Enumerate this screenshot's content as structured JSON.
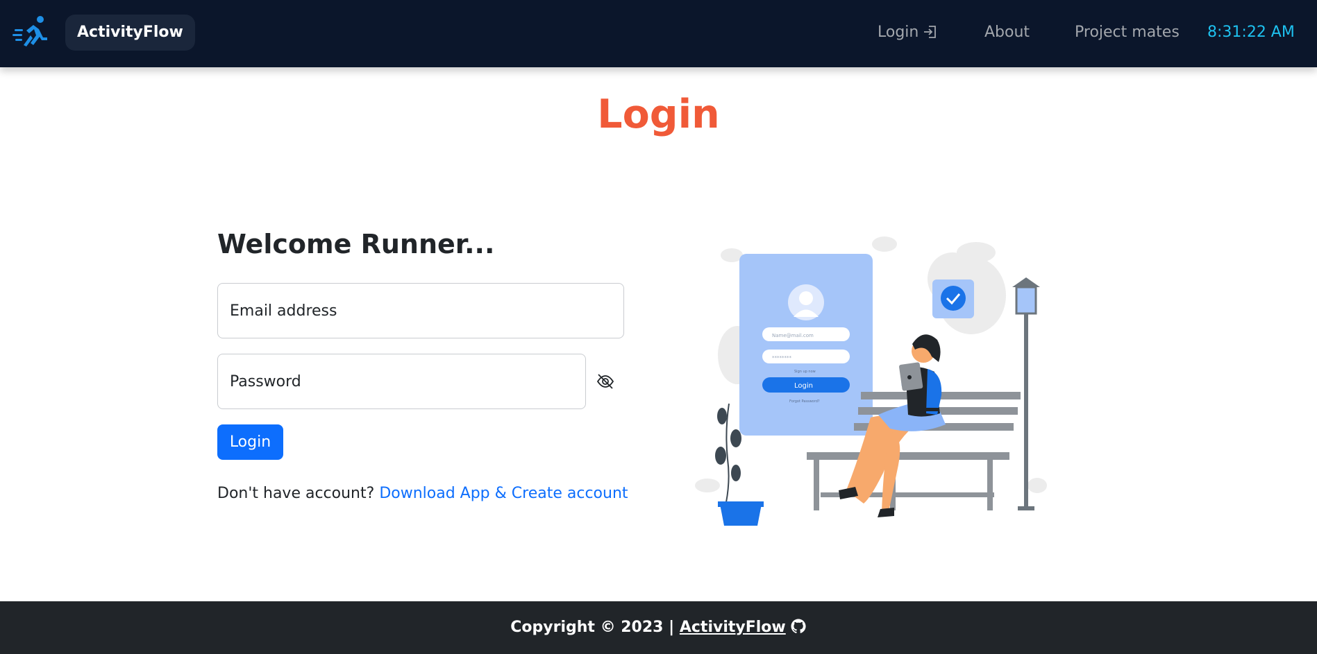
{
  "navbar": {
    "brand": "ActivityFlow",
    "logo_icon": "runner-icon",
    "links": [
      {
        "label": "Login",
        "icon": "login-arrow-icon"
      },
      {
        "label": "About"
      },
      {
        "label": "Project mates"
      }
    ],
    "clock": "8:31:22 AM"
  },
  "page": {
    "title": "Login"
  },
  "form": {
    "heading": "Welcome Runner...",
    "email_placeholder": "Email address",
    "password_placeholder": "Password",
    "password_toggle_icon": "eye-slash-icon",
    "submit_label": "Login",
    "signup_prompt": "Don't have account?",
    "signup_link": "Download App & Create account"
  },
  "illustration": {
    "card_email_placeholder": "Name@mail.com",
    "card_password_mask": "********",
    "card_signup": "Sign up now",
    "card_button": "Login",
    "card_forgot": "Forgot Password?"
  },
  "footer": {
    "text": "Copyright © 2023 |",
    "link": "ActivityFlow",
    "icon": "github-icon"
  },
  "colors": {
    "navbar_bg": "#0b162b",
    "accent": "#f05a38",
    "primary": "#0d6efd",
    "clock": "#1ec1ef",
    "footer_bg": "#212529"
  }
}
